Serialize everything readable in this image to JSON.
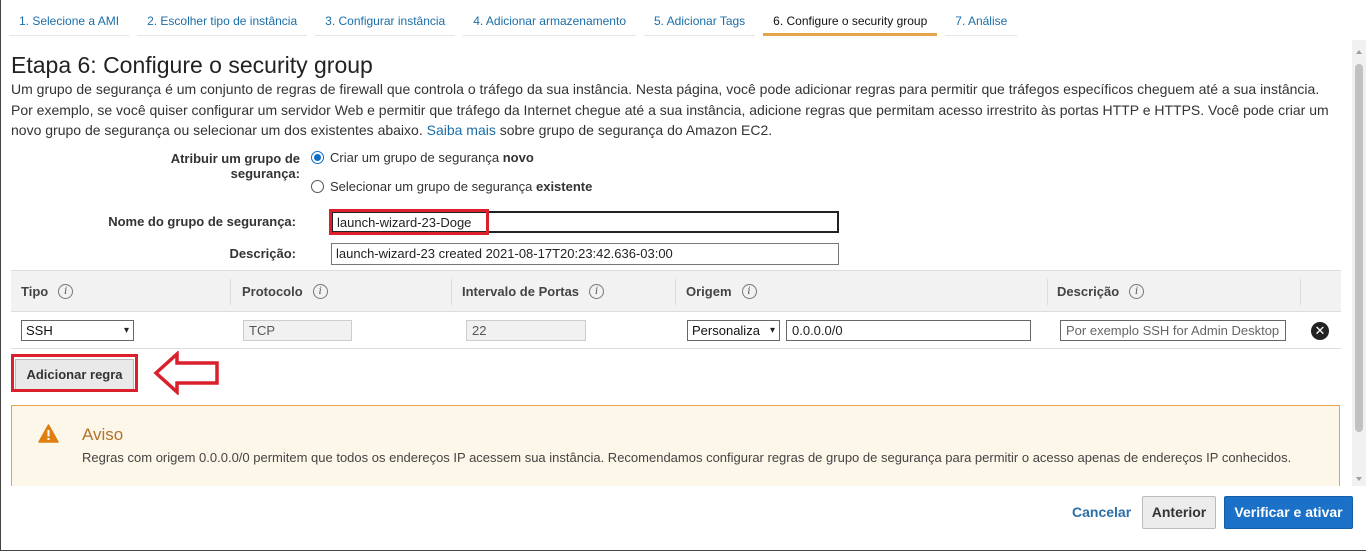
{
  "tabs": [
    {
      "label": "1. Selecione a AMI",
      "active": false
    },
    {
      "label": "2. Escolher tipo de instância",
      "active": false
    },
    {
      "label": "3. Configurar instância",
      "active": false
    },
    {
      "label": "4. Adicionar armazenamento",
      "active": false
    },
    {
      "label": "5. Adicionar Tags",
      "active": false
    },
    {
      "label": "6. Configure o security group",
      "active": true
    },
    {
      "label": "7. Análise",
      "active": false
    }
  ],
  "page": {
    "title": "Etapa 6: Configure o security group",
    "intro_text": "Um grupo de segurança é um conjunto de regras de firewall que controla o tráfego da sua instância. Nesta página, você pode adicionar regras para permitir que tráfegos específicos cheguem até a sua instância. Por exemplo, se você quiser configurar um servidor Web e permitir que tráfego da Internet chegue até a sua instância, adicione regras que permitam acesso irrestrito às portas HTTP e HTTPS. Você pode criar um novo grupo de segurança ou selecionar um dos existentes abaixo.",
    "learn_more_link": "Saiba mais",
    "intro_suffix": "sobre grupo de segurança do Amazon EC2."
  },
  "assign": {
    "label": "Atribuir um grupo de segurança:",
    "option_new_prefix": "Criar um grupo de segurança",
    "option_new_bold": "novo",
    "option_existing_prefix": "Selecionar um grupo de segurança",
    "option_existing_bold": "existente",
    "selected": "new"
  },
  "group_name": {
    "label": "Nome do grupo de segurança:",
    "value": "launch-wizard-23-Doge"
  },
  "description": {
    "label": "Descrição:",
    "value": "launch-wizard-23 created 2021-08-17T20:23:42.636-03:00"
  },
  "rules_table": {
    "columns": [
      "Tipo",
      "Protocolo",
      "Intervalo de Portas",
      "Origem",
      "Descrição"
    ],
    "info_glyph": "i",
    "rows": [
      {
        "type": "SSH",
        "protocol": "TCP",
        "port_range": "22",
        "source_select": "Personaliza",
        "source_cidr": "0.0.0.0/0",
        "description_placeholder": "Por exemplo SSH for Admin Desktop"
      }
    ],
    "remove_glyph": "✕"
  },
  "add_rule_button": "Adicionar regra",
  "warning": {
    "title": "Aviso",
    "text": "Regras com origem 0.0.0.0/0 permitem que todos os endereços IP acessem sua instância. Recomendamos configurar regras de grupo de segurança para permitir o acesso apenas de endereços IP conhecidos."
  },
  "footer": {
    "cancel": "Cancelar",
    "previous": "Anterior",
    "review_launch": "Verificar e ativar"
  },
  "colors": {
    "link": "#1a6ea8",
    "active_tab_underline": "#e6a54a",
    "primary_button": "#1b70c8",
    "annotation_red": "#d9202c",
    "warning_bg": "#fdf7e9",
    "warning_border": "#e6a54a"
  }
}
